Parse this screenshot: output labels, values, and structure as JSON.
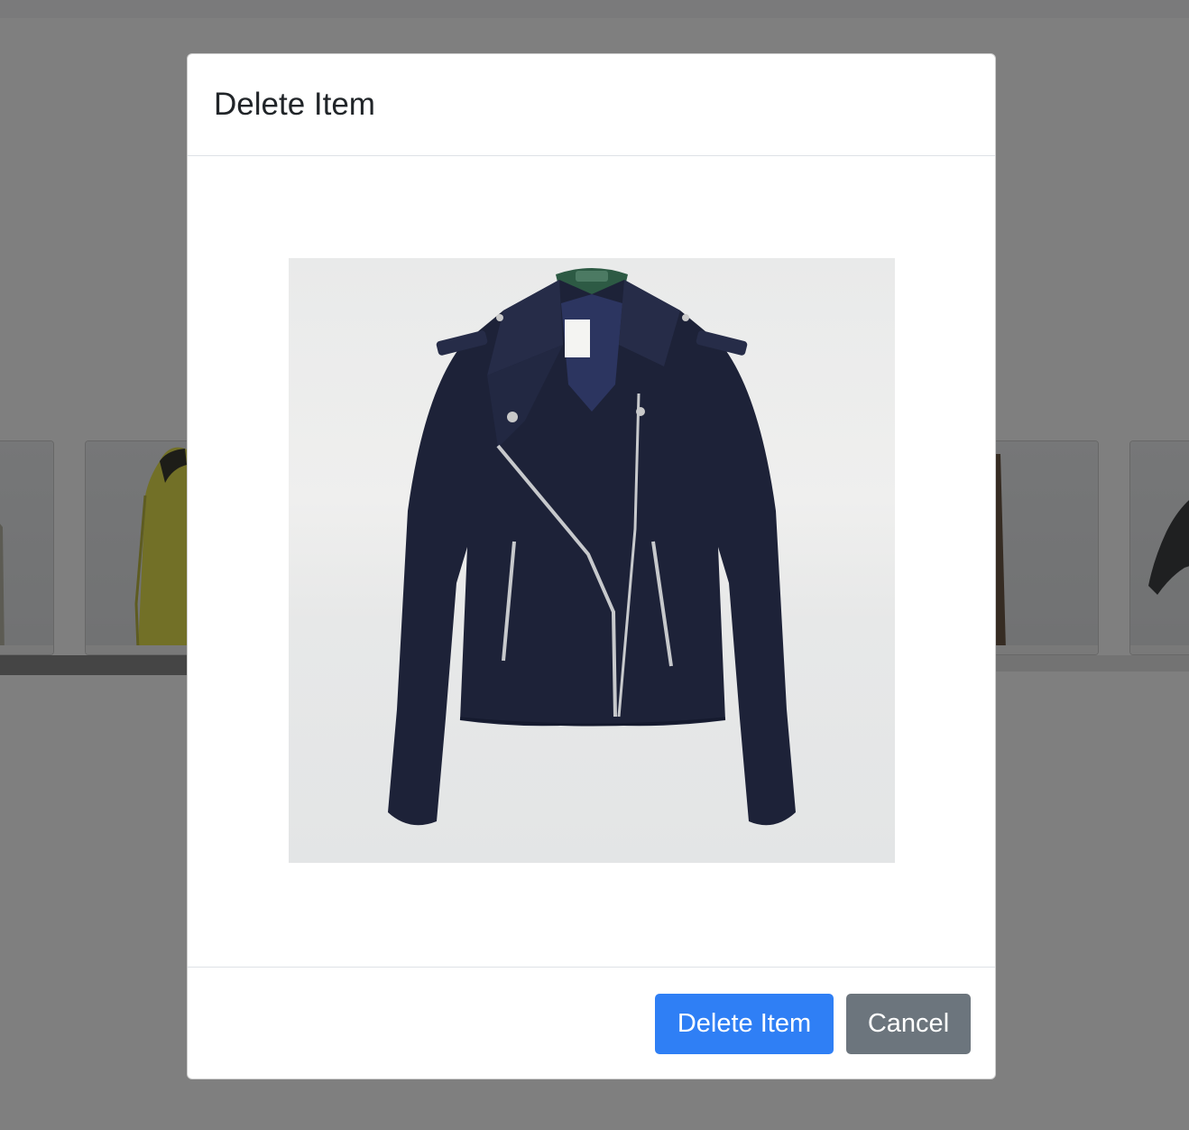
{
  "modal": {
    "title": "Delete Item",
    "image": {
      "icon": "jacket-photo",
      "colors": {
        "jacket": "#1d2238",
        "background": "#eaebeb",
        "hanger": "#2d5a44"
      }
    },
    "delete_button_label": "Delete Item",
    "cancel_button_label": "Cancel"
  },
  "background_gallery": {
    "thumbnails": [
      {
        "icon": "garment-thumbnail-partial"
      },
      {
        "icon": "yellow-raincoat-thumbnail"
      },
      {
        "icon": "brown-coat-thumbnail"
      },
      {
        "icon": "grey-jacket-thumbnail"
      }
    ]
  },
  "colors": {
    "primary": "#2f7ff5",
    "secondary": "#6c757d",
    "overlay": "rgba(0,0,0,0.5)"
  }
}
